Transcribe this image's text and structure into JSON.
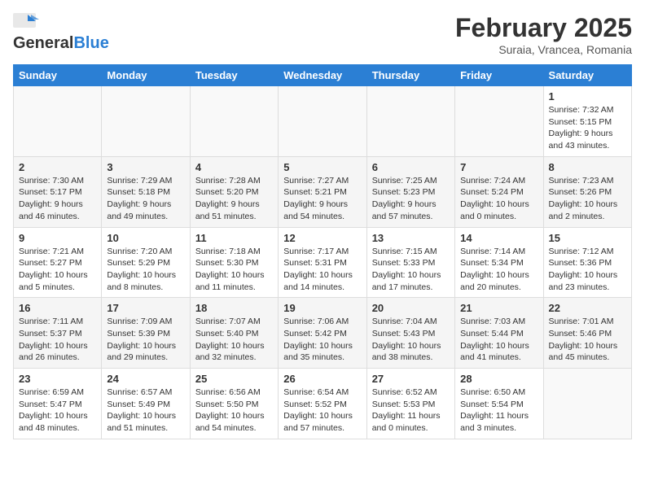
{
  "header": {
    "logo_general": "General",
    "logo_blue": "Blue",
    "month_title": "February 2025",
    "subtitle": "Suraia, Vrancea, Romania"
  },
  "weekdays": [
    "Sunday",
    "Monday",
    "Tuesday",
    "Wednesday",
    "Thursday",
    "Friday",
    "Saturday"
  ],
  "weeks": [
    [
      {
        "day": "",
        "info": ""
      },
      {
        "day": "",
        "info": ""
      },
      {
        "day": "",
        "info": ""
      },
      {
        "day": "",
        "info": ""
      },
      {
        "day": "",
        "info": ""
      },
      {
        "day": "",
        "info": ""
      },
      {
        "day": "1",
        "info": "Sunrise: 7:32 AM\nSunset: 5:15 PM\nDaylight: 9 hours and 43 minutes."
      }
    ],
    [
      {
        "day": "2",
        "info": "Sunrise: 7:30 AM\nSunset: 5:17 PM\nDaylight: 9 hours and 46 minutes."
      },
      {
        "day": "3",
        "info": "Sunrise: 7:29 AM\nSunset: 5:18 PM\nDaylight: 9 hours and 49 minutes."
      },
      {
        "day": "4",
        "info": "Sunrise: 7:28 AM\nSunset: 5:20 PM\nDaylight: 9 hours and 51 minutes."
      },
      {
        "day": "5",
        "info": "Sunrise: 7:27 AM\nSunset: 5:21 PM\nDaylight: 9 hours and 54 minutes."
      },
      {
        "day": "6",
        "info": "Sunrise: 7:25 AM\nSunset: 5:23 PM\nDaylight: 9 hours and 57 minutes."
      },
      {
        "day": "7",
        "info": "Sunrise: 7:24 AM\nSunset: 5:24 PM\nDaylight: 10 hours and 0 minutes."
      },
      {
        "day": "8",
        "info": "Sunrise: 7:23 AM\nSunset: 5:26 PM\nDaylight: 10 hours and 2 minutes."
      }
    ],
    [
      {
        "day": "9",
        "info": "Sunrise: 7:21 AM\nSunset: 5:27 PM\nDaylight: 10 hours and 5 minutes."
      },
      {
        "day": "10",
        "info": "Sunrise: 7:20 AM\nSunset: 5:29 PM\nDaylight: 10 hours and 8 minutes."
      },
      {
        "day": "11",
        "info": "Sunrise: 7:18 AM\nSunset: 5:30 PM\nDaylight: 10 hours and 11 minutes."
      },
      {
        "day": "12",
        "info": "Sunrise: 7:17 AM\nSunset: 5:31 PM\nDaylight: 10 hours and 14 minutes."
      },
      {
        "day": "13",
        "info": "Sunrise: 7:15 AM\nSunset: 5:33 PM\nDaylight: 10 hours and 17 minutes."
      },
      {
        "day": "14",
        "info": "Sunrise: 7:14 AM\nSunset: 5:34 PM\nDaylight: 10 hours and 20 minutes."
      },
      {
        "day": "15",
        "info": "Sunrise: 7:12 AM\nSunset: 5:36 PM\nDaylight: 10 hours and 23 minutes."
      }
    ],
    [
      {
        "day": "16",
        "info": "Sunrise: 7:11 AM\nSunset: 5:37 PM\nDaylight: 10 hours and 26 minutes."
      },
      {
        "day": "17",
        "info": "Sunrise: 7:09 AM\nSunset: 5:39 PM\nDaylight: 10 hours and 29 minutes."
      },
      {
        "day": "18",
        "info": "Sunrise: 7:07 AM\nSunset: 5:40 PM\nDaylight: 10 hours and 32 minutes."
      },
      {
        "day": "19",
        "info": "Sunrise: 7:06 AM\nSunset: 5:42 PM\nDaylight: 10 hours and 35 minutes."
      },
      {
        "day": "20",
        "info": "Sunrise: 7:04 AM\nSunset: 5:43 PM\nDaylight: 10 hours and 38 minutes."
      },
      {
        "day": "21",
        "info": "Sunrise: 7:03 AM\nSunset: 5:44 PM\nDaylight: 10 hours and 41 minutes."
      },
      {
        "day": "22",
        "info": "Sunrise: 7:01 AM\nSunset: 5:46 PM\nDaylight: 10 hours and 45 minutes."
      }
    ],
    [
      {
        "day": "23",
        "info": "Sunrise: 6:59 AM\nSunset: 5:47 PM\nDaylight: 10 hours and 48 minutes."
      },
      {
        "day": "24",
        "info": "Sunrise: 6:57 AM\nSunset: 5:49 PM\nDaylight: 10 hours and 51 minutes."
      },
      {
        "day": "25",
        "info": "Sunrise: 6:56 AM\nSunset: 5:50 PM\nDaylight: 10 hours and 54 minutes."
      },
      {
        "day": "26",
        "info": "Sunrise: 6:54 AM\nSunset: 5:52 PM\nDaylight: 10 hours and 57 minutes."
      },
      {
        "day": "27",
        "info": "Sunrise: 6:52 AM\nSunset: 5:53 PM\nDaylight: 11 hours and 0 minutes."
      },
      {
        "day": "28",
        "info": "Sunrise: 6:50 AM\nSunset: 5:54 PM\nDaylight: 11 hours and 3 minutes."
      },
      {
        "day": "",
        "info": ""
      }
    ]
  ]
}
